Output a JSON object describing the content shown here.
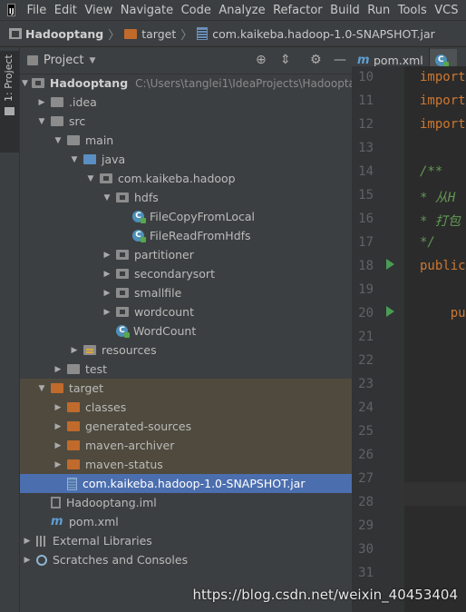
{
  "menu": {
    "logo_text": "IJ",
    "items": [
      "File",
      "Edit",
      "View",
      "Navigate",
      "Code",
      "Analyze",
      "Refactor",
      "Build",
      "Run",
      "Tools",
      "VCS"
    ]
  },
  "breadcrumb": {
    "project": "Hadooptang",
    "folder": "target",
    "file": "com.kaikeba.hadoop-1.0-SNAPSHOT.jar"
  },
  "side_stripe": {
    "label": "1: Project"
  },
  "project_panel": {
    "title": "Project"
  },
  "tree": [
    {
      "label": "Hadooptang",
      "path": "C:\\Users\\tanglei1\\IdeaProjects\\Hadooptang"
    },
    {
      "label": ".idea"
    },
    {
      "label": "src"
    },
    {
      "label": "main"
    },
    {
      "label": "java"
    },
    {
      "label": "com.kaikeba.hadoop"
    },
    {
      "label": "hdfs"
    },
    {
      "label": "FileCopyFromLocal"
    },
    {
      "label": "FileReadFromHdfs"
    },
    {
      "label": "partitioner"
    },
    {
      "label": "secondarysort"
    },
    {
      "label": "smallfile"
    },
    {
      "label": "wordcount"
    },
    {
      "label": "WordCount"
    },
    {
      "label": "resources"
    },
    {
      "label": "test"
    },
    {
      "label": "target"
    },
    {
      "label": "classes"
    },
    {
      "label": "generated-sources"
    },
    {
      "label": "maven-archiver"
    },
    {
      "label": "maven-status"
    },
    {
      "label": "com.kaikeba.hadoop-1.0-SNAPSHOT.jar"
    },
    {
      "label": "Hadooptang.iml"
    },
    {
      "label": "pom.xml"
    },
    {
      "label": "External Libraries"
    },
    {
      "label": "Scratches and Consoles"
    }
  ],
  "editor": {
    "tab_label": "pom.xml",
    "line_numbers": [
      "10",
      "11",
      "12",
      "13",
      "14",
      "15",
      "16",
      "17",
      "18",
      "19",
      "20",
      "21",
      "22",
      "23",
      "24",
      "25",
      "26",
      "27",
      "28",
      "29",
      "30",
      "31"
    ],
    "code": {
      "l10": "import",
      "l11": "import",
      "l12": "import",
      "l14": "/**",
      "l15": " * 从H",
      "l16": " * 打包",
      "l17": " */",
      "l18": "public",
      "l20": "    pu"
    }
  },
  "watermark": "https://blog.csdn.net/weixin_40453404"
}
